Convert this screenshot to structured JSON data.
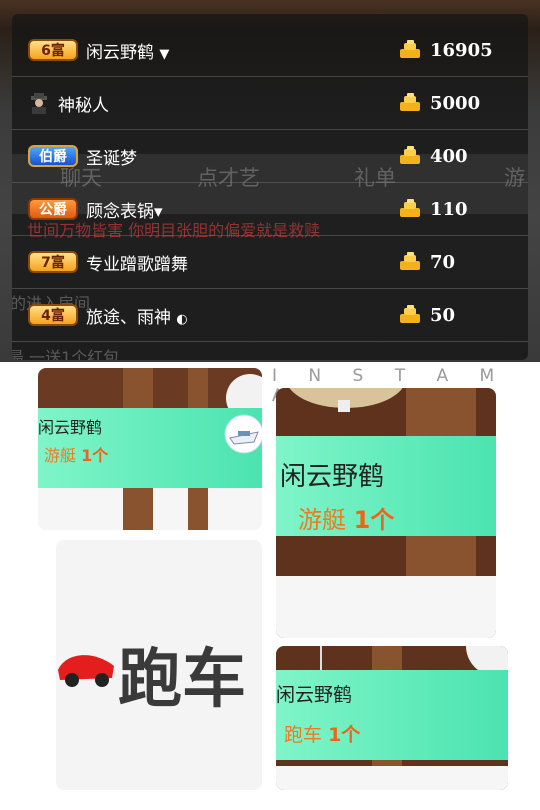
{
  "ranking": [
    {
      "badge": "6富",
      "badge_style": "gold",
      "name": "闲云野鹤",
      "coins": "16905"
    },
    {
      "badge": "",
      "badge_style": "spy",
      "name": "神秘人",
      "coins": "5000"
    },
    {
      "badge": "伯爵",
      "badge_style": "blue",
      "name": "圣诞梦",
      "coins": "400"
    },
    {
      "badge": "公爵",
      "badge_style": "orange",
      "name": "顾念表锅▾",
      "coins": "110"
    },
    {
      "badge": "7富",
      "badge_style": "gold",
      "name": "专业蹭歌蹭舞",
      "coins": "70"
    },
    {
      "badge": "4富",
      "badge_style": "gold",
      "name": "旅途、雨神",
      "coins": "50"
    }
  ],
  "background_tabs": [
    "聊天",
    "点才艺",
    "礼单",
    "游"
  ],
  "background_text": [
    "：  世间万物皆害 你明目张胆的偏爱就是救赎",
    "的进入房间",
    "最 一送1个红包"
  ],
  "watermark": "I N S T A M A G",
  "tiles": {
    "tile1": {
      "name": "闲云野鹤",
      "gift": "游艇",
      "count": "1个"
    },
    "tile2": {
      "name": "闲云野鹤",
      "gift": "游艇",
      "count": "1个"
    },
    "tile3": {
      "text": "跑车"
    },
    "tile4": {
      "name": "闲云野鹤",
      "gift": "跑车",
      "count": "1个"
    }
  },
  "colors": {
    "coin": "#f3b21b",
    "gift_text": "#ee7a22",
    "banner_green": "#6ff0c2",
    "wood": "#6a3b22"
  }
}
